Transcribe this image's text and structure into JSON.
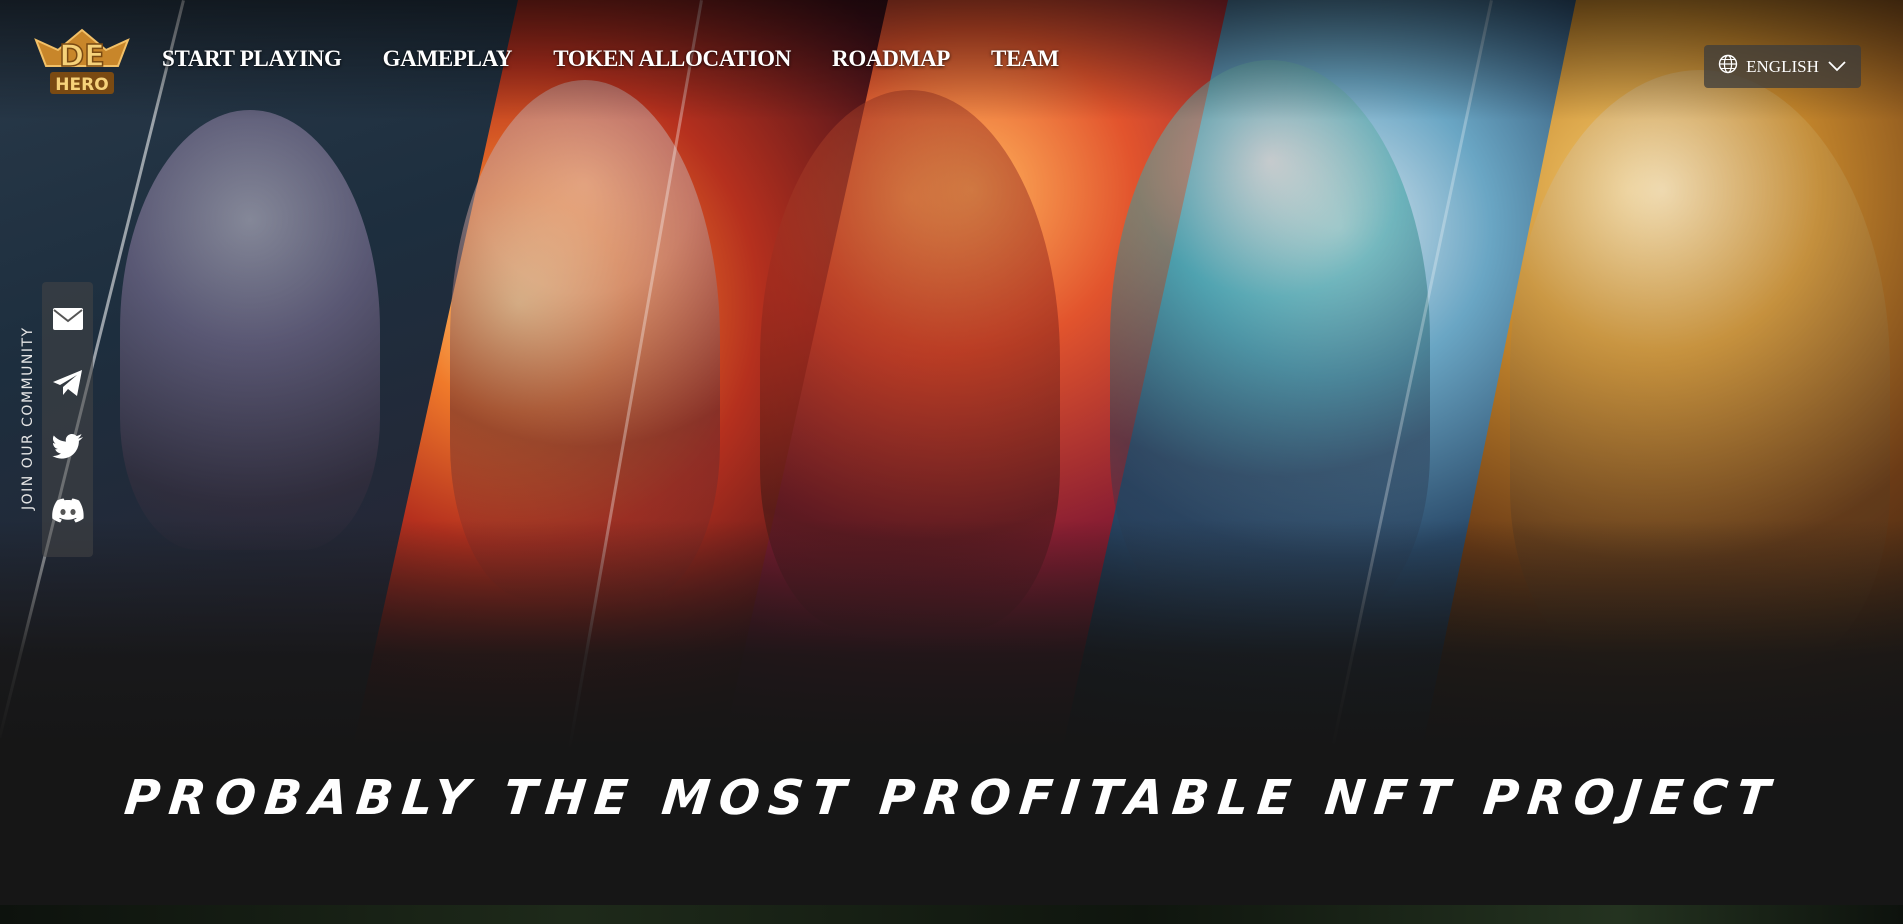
{
  "brand": {
    "logo_top": "DE",
    "logo_bottom": "HERO"
  },
  "nav": {
    "items": [
      {
        "label": "START PLAYING"
      },
      {
        "label": "GAMEPLAY"
      },
      {
        "label": "TOKEN ALLOCATION"
      },
      {
        "label": "ROADMAP"
      },
      {
        "label": "TEAM"
      }
    ]
  },
  "language": {
    "label": "ENGLISH",
    "icon": "globe-icon",
    "chevron": "chevron-down-icon"
  },
  "community": {
    "label": "JOIN OUR COMMUNITY",
    "icons": [
      "mail-icon",
      "telegram-icon",
      "twitter-icon",
      "discord-icon"
    ]
  },
  "hero": {
    "tagline": "PROBABLY THE MOST PROFITABLE NFT PROJECT"
  },
  "colors": {
    "accent_gold": "#e8a43a",
    "background": "#161616",
    "text": "#ffffff"
  }
}
